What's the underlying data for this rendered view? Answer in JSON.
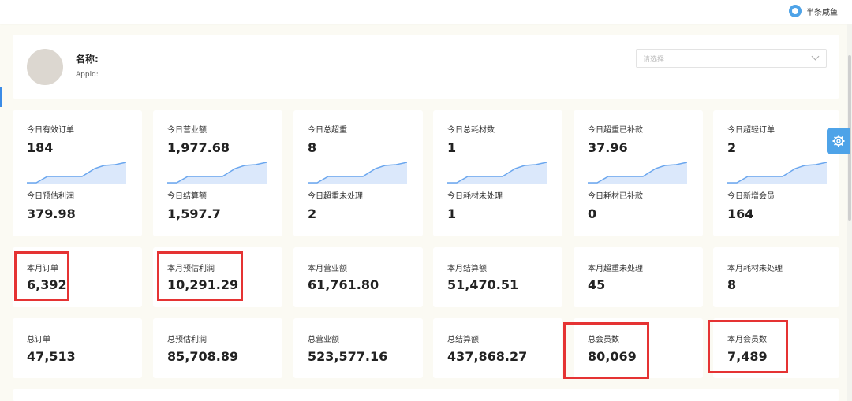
{
  "header": {
    "username": "半条咸鱼"
  },
  "profile": {
    "name_label": "名称:",
    "appid_label": "Appid:",
    "select_placeholder": "请选择"
  },
  "today": [
    {
      "label": "今日有效订单",
      "value": "184",
      "sub_label": "今日预估利润",
      "sub_value": "379.98"
    },
    {
      "label": "今日营业额",
      "value": "1,977.68",
      "sub_label": "今日结算额",
      "sub_value": "1,597.7"
    },
    {
      "label": "今日总超重",
      "value": "8",
      "sub_label": "今日超重未处理",
      "sub_value": "2"
    },
    {
      "label": "今日总耗材数",
      "value": "1",
      "sub_label": "今日耗材未处理",
      "sub_value": "1"
    },
    {
      "label": "今日超重已补款",
      "value": "37.96",
      "sub_label": "今日耗材已补款",
      "sub_value": "0"
    },
    {
      "label": "今日超轻订单",
      "value": "2",
      "sub_label": "今日新增会员",
      "sub_value": "164"
    }
  ],
  "month": [
    {
      "label": "本月订单",
      "value": "6,392"
    },
    {
      "label": "本月预估利润",
      "value": "10,291.29"
    },
    {
      "label": "本月营业额",
      "value": "61,761.80"
    },
    {
      "label": "本月结算额",
      "value": "51,470.51"
    },
    {
      "label": "本月超重未处理",
      "value": "45"
    },
    {
      "label": "本月耗材未处理",
      "value": "8"
    }
  ],
  "total": [
    {
      "label": "总订单",
      "value": "47,513"
    },
    {
      "label": "总预估利润",
      "value": "85,708.89"
    },
    {
      "label": "总营业额",
      "value": "523,577.16"
    },
    {
      "label": "总结算额",
      "value": "437,868.27"
    },
    {
      "label": "总会员数",
      "value": "80,069"
    },
    {
      "label": "本月会员数",
      "value": "7,489"
    }
  ],
  "colors": {
    "accent": "#4ea3e8",
    "highlight": "#e53333",
    "background": "#fbfaf3"
  },
  "icons": {
    "settings": "gear-icon",
    "dropdown": "chevron-down-icon"
  }
}
